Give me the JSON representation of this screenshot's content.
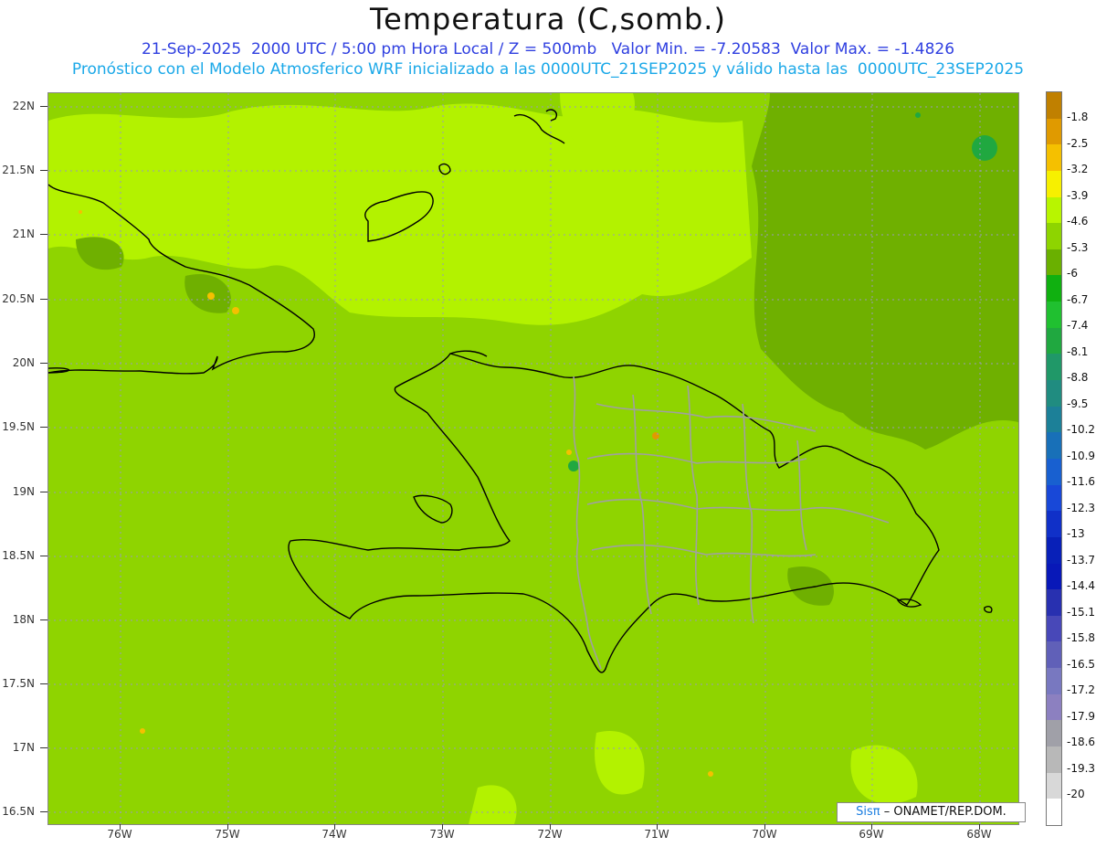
{
  "header": {
    "title": "Temperatura (C,somb.)",
    "subtitle1": "21-Sep-2025  2000 UTC / 5:00 pm Hora Local / Z = 500mb   Valor Min. = -7.20583  Valor Max. = -1.4826",
    "subtitle2": "Pronóstico con el Modelo Atmosferico WRF inicializado a las 0000UTC_21SEP2025 y válido hasta las  0000UTC_23SEP2025"
  },
  "map": {
    "lat_labels": [
      "22N",
      "21.5N",
      "21N",
      "20.5N",
      "20N",
      "19.5N",
      "19N",
      "18.5N",
      "18N",
      "17.5N",
      "17N",
      "16.5N"
    ],
    "lon_labels": [
      "76W",
      "75W",
      "74W",
      "73W",
      "72W",
      "71W",
      "70W",
      "69W",
      "68W"
    ],
    "base_color": "#8fd400",
    "light_color": "#b3f200",
    "dark_color": "#6fb000",
    "coast_color": "#000000",
    "border_color": "#a0a0a0"
  },
  "colorbar": {
    "labels": [
      "-1.8",
      "-2.5",
      "-3.2",
      "-3.9",
      "-4.6",
      "-5.3",
      "-6",
      "-6.7",
      "-7.4",
      "-8.1",
      "-8.8",
      "-9.5",
      "-10.2",
      "-10.9",
      "-11.6",
      "-12.3",
      "-13",
      "-13.7",
      "-14.4",
      "-15.1",
      "-15.8",
      "-16.5",
      "-17.2",
      "-17.9",
      "-18.6",
      "-19.3",
      "-20"
    ],
    "colors": [
      "#c08000",
      "#e09a00",
      "#f5c000",
      "#f7f000",
      "#b8f500",
      "#8ed400",
      "#6ab000",
      "#10b010",
      "#20c030",
      "#20a840",
      "#209868",
      "#208c80",
      "#1c8098",
      "#1870b8",
      "#1860d0",
      "#1848d8",
      "#1030c8",
      "#0820b8",
      "#0818b8",
      "#2830b0",
      "#4848b8",
      "#6060b8",
      "#7878c0",
      "#8c80c0",
      "#a0a0a8",
      "#b8b8b8",
      "#d8d8d8",
      "#ffffff"
    ]
  },
  "credit": {
    "brand": "Sisπ",
    "org": "– ONAMET/REP.DOM."
  }
}
